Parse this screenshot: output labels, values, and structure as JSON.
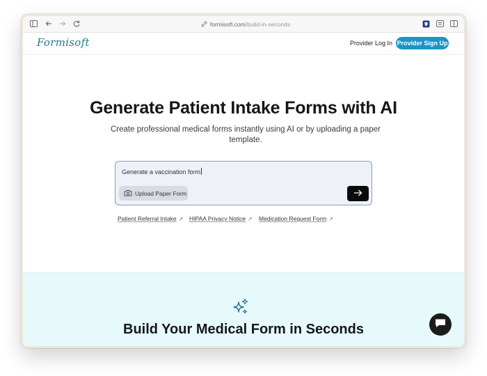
{
  "browser": {
    "url_domain": "formisoft.com",
    "url_path": "/build-in-seconds"
  },
  "header": {
    "logo": "Formisoft",
    "login_label": "Provider Log In",
    "signup_label": "Provider Sign Up"
  },
  "hero": {
    "title": "Generate Patient Intake Forms with AI",
    "subtitle": "Create professional medical forms instantly using AI or by uploading a paper template.",
    "prompt_value": "Generate a vaccination form",
    "upload_label": "Upload Paper Form",
    "suggestions": [
      {
        "label": "Patient Referral Intake"
      },
      {
        "label": "HIPAA Privacy Notice"
      },
      {
        "label": "Medication Request Form"
      }
    ]
  },
  "section": {
    "title": "Build Your Medical Form in Seconds"
  },
  "colors": {
    "brand": "#1f7a92",
    "accent_button": "#1b95c6",
    "section_bg": "#e6fafc"
  },
  "icons": {
    "sidebar": "sidebar-icon",
    "back": "back-arrow-icon",
    "forward": "forward-arrow-icon",
    "reload": "reload-icon",
    "link": "link-icon",
    "upload": "camera-icon",
    "send": "arrow-right-icon",
    "sparkle": "sparkles-icon",
    "chat": "chat-bubble-icon"
  }
}
